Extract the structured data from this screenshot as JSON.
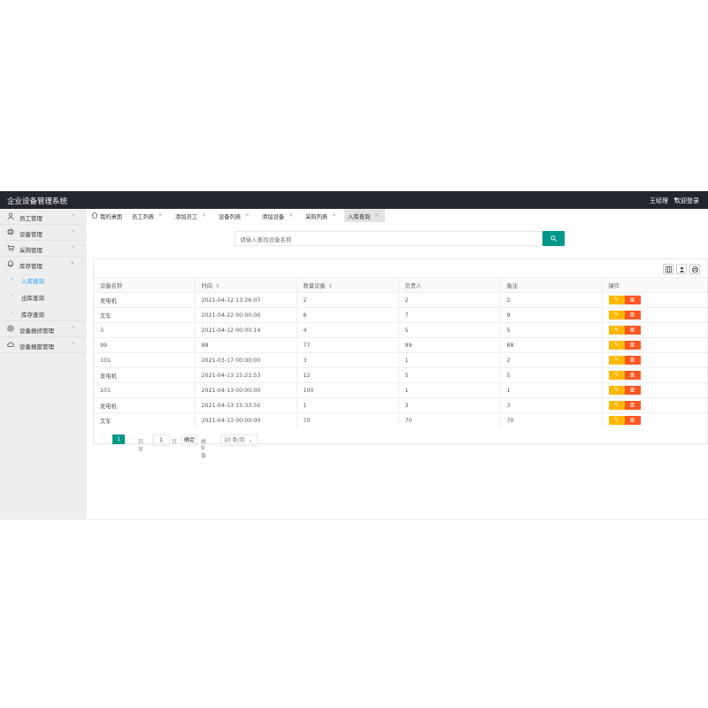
{
  "header": {
    "app_title": "企业设备管理系统",
    "user_name": "王经理",
    "logout": "欢迎登录"
  },
  "sidebar": {
    "items": [
      {
        "label": "员工管理",
        "icon": "user-icon"
      },
      {
        "label": "设备管理",
        "icon": "device-icon"
      },
      {
        "label": "采购管理",
        "icon": "cart-icon"
      },
      {
        "label": "库存管理",
        "icon": "bell-icon"
      },
      {
        "label": "设备报修管理",
        "icon": "settings-icon"
      },
      {
        "label": "设备报废管理",
        "icon": "cloud-icon"
      }
    ],
    "sub_items": [
      {
        "label": "入库查询",
        "active": true
      },
      {
        "label": "出库查询",
        "active": false
      },
      {
        "label": "库存查询",
        "active": false
      }
    ]
  },
  "tabs": [
    {
      "label": "我的桌面"
    },
    {
      "label": "员工列表"
    },
    {
      "label": "添加员工"
    },
    {
      "label": "设备列表"
    },
    {
      "label": "添加设备"
    },
    {
      "label": "采购列表"
    },
    {
      "label": "入库查询"
    }
  ],
  "search": {
    "placeholder": "请输入查找设备名称"
  },
  "table": {
    "columns": [
      "设备名称",
      "时间",
      "数量设备",
      "负责人",
      "备注",
      "操作"
    ],
    "rows": [
      [
        "发电机",
        "2021-04-12 13:26:07",
        "2",
        "2",
        "2"
      ],
      [
        "叉车",
        "2021-04-22 00:00:00",
        "6",
        "7",
        "9"
      ],
      [
        "3",
        "2021-04-12 00:00:14",
        "4",
        "5",
        "5"
      ],
      [
        "99",
        "88",
        "77",
        "99",
        "88"
      ],
      [
        "101",
        "2021-03-17 00:00:00",
        "3",
        "1",
        "2"
      ],
      [
        "发电机",
        "2021-04-13 15:21:53",
        "12",
        "5",
        "5"
      ],
      [
        "101",
        "2021-04-13 00:00:00",
        "100",
        "1",
        "1"
      ],
      [
        "发电机",
        "2021-04-13 15:33:50",
        "1",
        "3",
        "3"
      ],
      [
        "叉车",
        "2021-04-13 00:00:00",
        "70",
        "70",
        "70"
      ]
    ]
  },
  "pager": {
    "current": "1",
    "goto_label": "到第",
    "goto_value": "1",
    "page_unit": "页",
    "confirm": "确定",
    "total": "共 9 条",
    "page_size": "10 条/页"
  },
  "colors": {
    "header_bg": "#23262e",
    "accent": "#009688",
    "edit": "#ffb800",
    "delete": "#ff5722",
    "link_active": "#1e9fff"
  }
}
